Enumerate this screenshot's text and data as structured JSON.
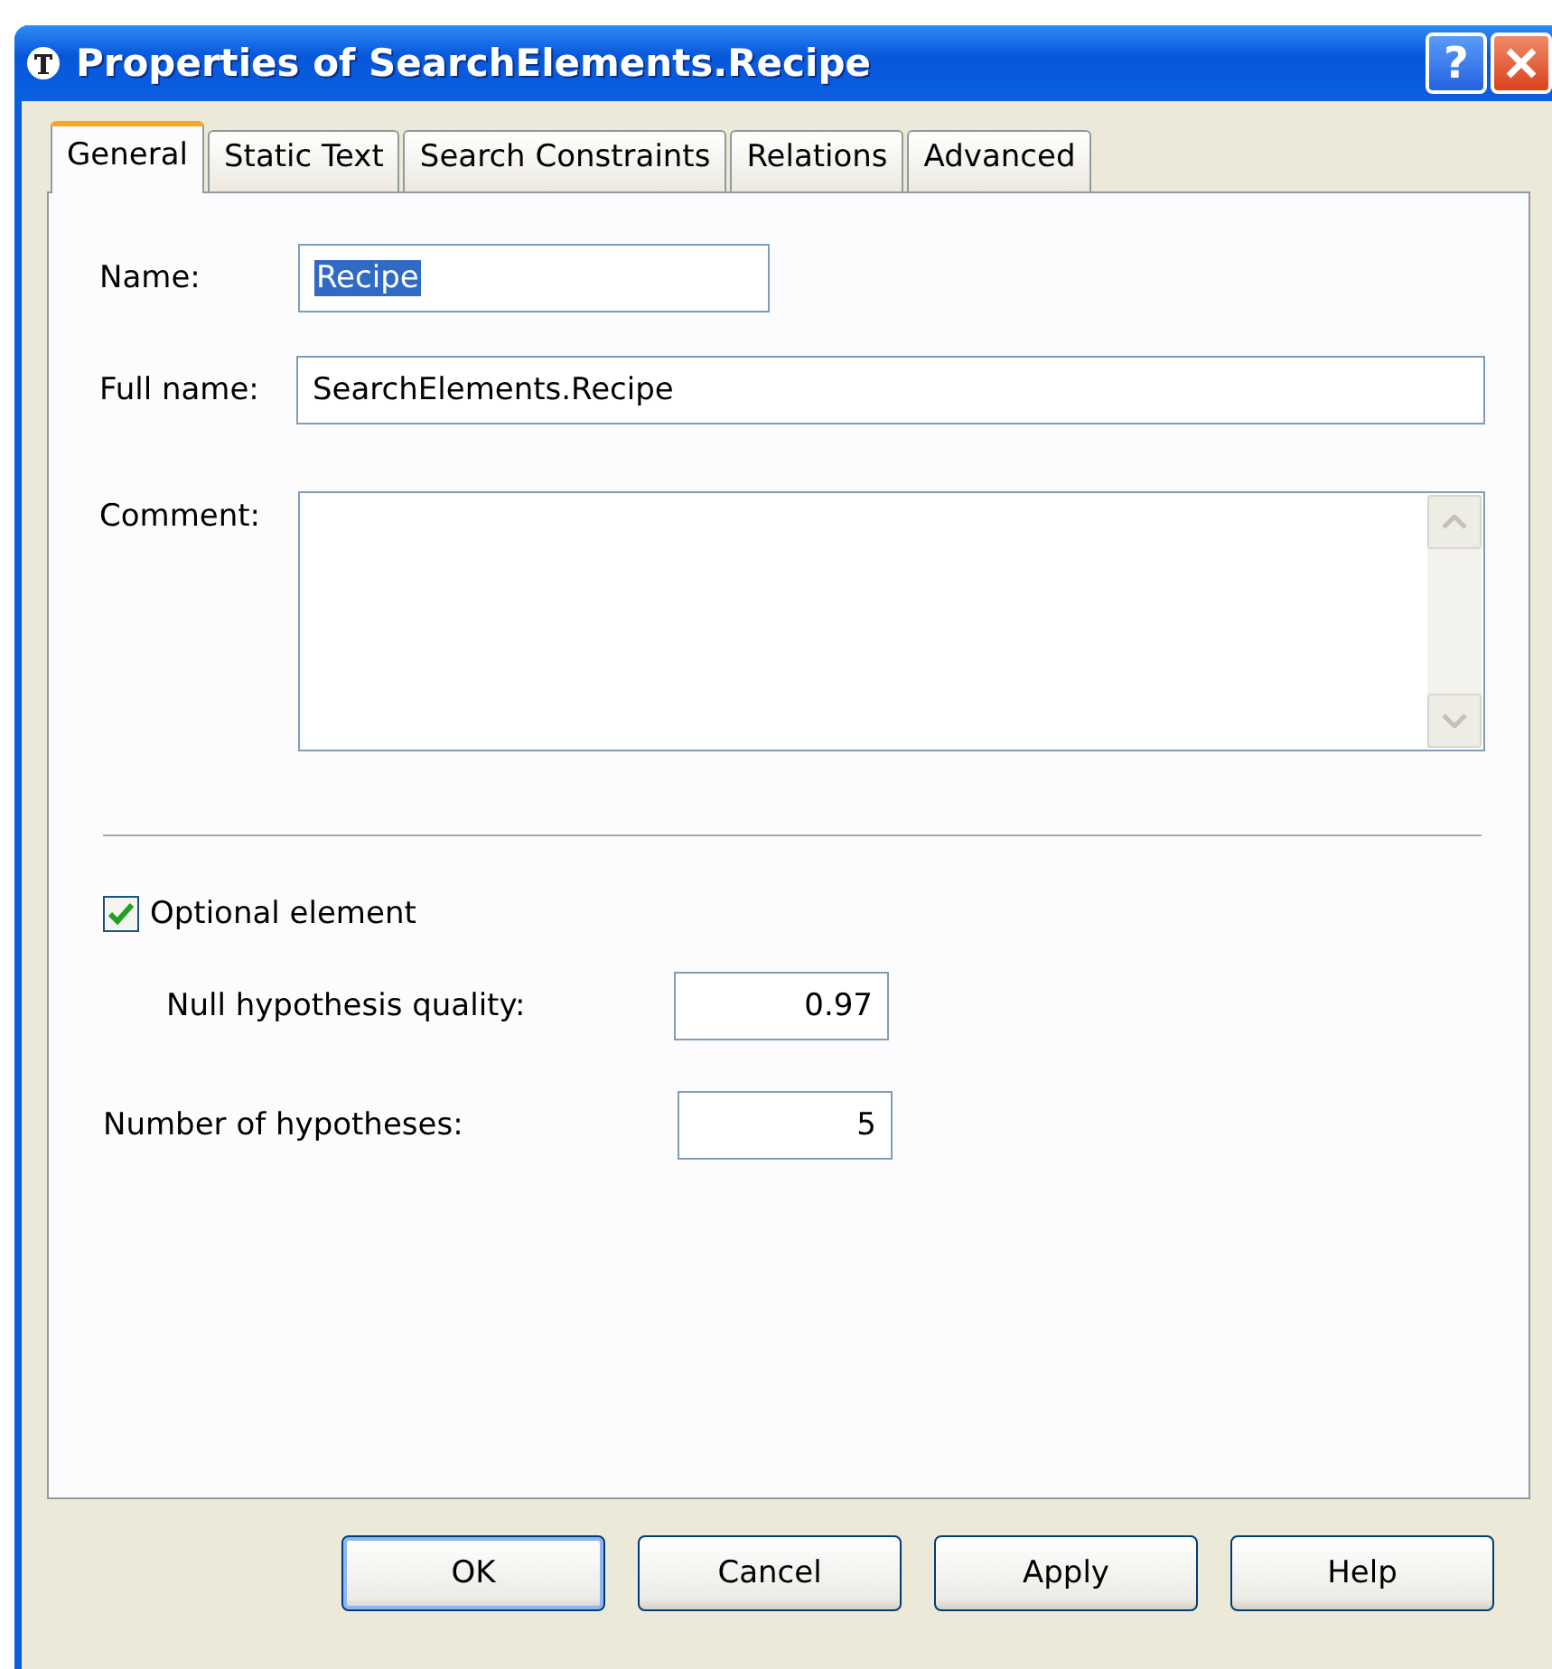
{
  "window": {
    "title": "Properties of SearchElements.Recipe",
    "help_button": "?"
  },
  "tabs": [
    {
      "label": "General",
      "selected": true
    },
    {
      "label": "Static Text",
      "selected": false
    },
    {
      "label": "Search Constraints",
      "selected": false
    },
    {
      "label": "Relations",
      "selected": false
    },
    {
      "label": "Advanced",
      "selected": false
    }
  ],
  "name_field": {
    "label": "Name:",
    "value": "Recipe",
    "text_selected": true
  },
  "full_name_field": {
    "label": "Full name:",
    "value": "SearchElements.Recipe"
  },
  "comment_field": {
    "label": "Comment:"
  },
  "optional_element": {
    "label": "Optional element",
    "checked": true
  },
  "null_hypothesis_quality": {
    "label": "Null hypothesis quality:",
    "value": "0.97"
  },
  "number_of_hypotheses": {
    "label": "Number of hypotheses:",
    "value": "5"
  },
  "buttons": [
    {
      "label": "OK",
      "default": true
    },
    {
      "label": "Cancel",
      "default": false
    },
    {
      "label": "Apply",
      "default": false
    },
    {
      "label": "Help",
      "default": false
    }
  ]
}
